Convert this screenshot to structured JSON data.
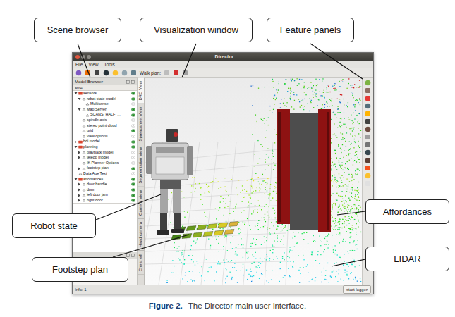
{
  "window": {
    "title": "Director"
  },
  "menu": [
    "File",
    "View",
    "Tools"
  ],
  "toolbar": {
    "walk_label": "Walk plan:"
  },
  "model_browser": {
    "title": "Model Browser",
    "column": "ame",
    "items": [
      {
        "label": "sensors",
        "depth": 0,
        "kind": "folder",
        "expanded": true,
        "visible": true
      },
      {
        "label": "robot state model",
        "depth": 1,
        "kind": "group",
        "expanded": true,
        "visible": true
      },
      {
        "label": "Multisense",
        "depth": 2,
        "kind": "object",
        "visible": false
      },
      {
        "label": "Map Server",
        "depth": 1,
        "kind": "group",
        "expanded": true,
        "visible": true
      },
      {
        "label": "SCANS_HALF_...",
        "depth": 2,
        "kind": "object",
        "visible": true
      },
      {
        "label": "spindle axis",
        "depth": 1,
        "kind": "object",
        "visible": false
      },
      {
        "label": "stereo point cloud",
        "depth": 1,
        "kind": "object",
        "visible": false
      },
      {
        "label": "grid",
        "depth": 1,
        "kind": "object",
        "visible": true
      },
      {
        "label": "view options",
        "depth": 1,
        "kind": "object",
        "visible": false
      },
      {
        "label": "bdi model",
        "depth": 0,
        "kind": "folder",
        "expanded": false,
        "visible": true
      },
      {
        "label": "planning",
        "depth": 0,
        "kind": "folder",
        "expanded": true,
        "visible": true
      },
      {
        "label": "playback model",
        "depth": 1,
        "kind": "group",
        "expanded": false,
        "visible": false
      },
      {
        "label": "teleop model",
        "depth": 1,
        "kind": "group",
        "expanded": false,
        "visible": false
      },
      {
        "label": "IK Planner Options",
        "depth": 1,
        "kind": "object",
        "visible": false
      },
      {
        "label": "footstep plan",
        "depth": 1,
        "kind": "group",
        "expanded": false,
        "visible": true
      },
      {
        "label": "Data Age Text",
        "depth": 0,
        "kind": "object",
        "visible": false
      },
      {
        "label": "affordances",
        "depth": 0,
        "kind": "folder",
        "expanded": true,
        "visible": true
      },
      {
        "label": "door handle",
        "depth": 1,
        "kind": "group",
        "expanded": false,
        "visible": true
      },
      {
        "label": "door",
        "depth": 1,
        "kind": "group",
        "expanded": false,
        "visible": true
      },
      {
        "label": "left door jam",
        "depth": 1,
        "kind": "group",
        "expanded": false,
        "visible": true
      },
      {
        "label": "right door",
        "depth": 1,
        "kind": "group",
        "expanded": false,
        "visible": true
      }
    ]
  },
  "view_tabs": [
    {
      "label": "DRC View",
      "selected": true
    },
    {
      "label": "Spreadsheet View",
      "selected": false
    },
    {
      "label": "Segmentation View",
      "selected": false
    },
    {
      "label": "Camera View",
      "selected": false
    },
    {
      "label": "Head camera",
      "selected": false
    },
    {
      "label": "Chest left",
      "selected": false
    }
  ],
  "status_bar": {
    "info": "Info: 1",
    "button": "start logger"
  },
  "callouts": [
    {
      "label": "Scene browser"
    },
    {
      "label": "Visualization window"
    },
    {
      "label": "Feature panels"
    },
    {
      "label": "Robot state"
    },
    {
      "label": "Affordances"
    },
    {
      "label": "Footstep plan"
    },
    {
      "label": "LIDAR"
    }
  ],
  "caption": {
    "number": "Figure 2.",
    "text": "The Director main user interface."
  }
}
